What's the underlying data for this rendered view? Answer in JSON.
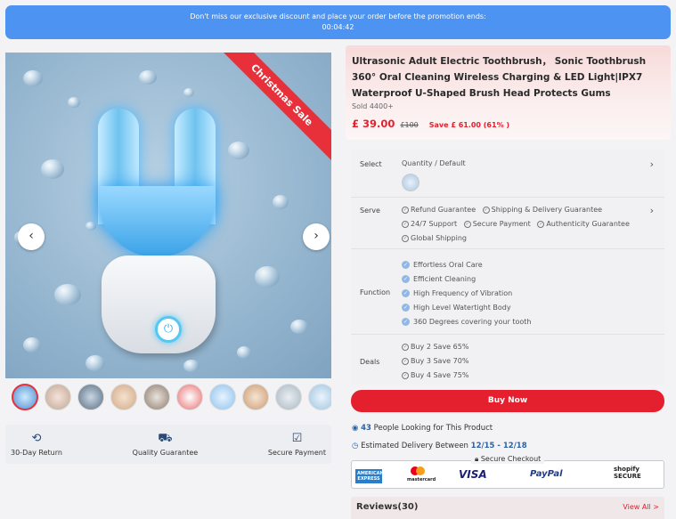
{
  "promo": {
    "message": "Don't miss our exclusive discount and place your order before the promotion ends:",
    "countdown": "00:04:42"
  },
  "gallery": {
    "ribbon": "Christmas Sale",
    "prev_icon": "chevron-left-icon",
    "next_icon": "chevron-right-icon",
    "thumbnail_count": 10
  },
  "guarantees": [
    {
      "label": "30-Day Return",
      "icon": "dollar-return-icon"
    },
    {
      "label": "Quality Guarantee",
      "icon": "truck-icon"
    },
    {
      "label": "Secure Payment",
      "icon": "secure-check-icon"
    }
  ],
  "product": {
    "title": "Ultrasonic Adult Electric Toothbrush， Sonic Toothbrush 360° Oral Cleaning Wireless Charging & LED Light|IPX7 Waterproof U-Shaped Brush Head Protects Gums",
    "sold": "Sold 4400+",
    "price": "£ 39.00",
    "old_price": "£100",
    "save": "Save £ 61.00 (61% )"
  },
  "specs": {
    "select_label": "Select",
    "select_value": "Quantity / Default",
    "serve_label": "Serve",
    "serve_items": [
      "Refund Guarantee",
      "Shipping & Delivery Guarantee",
      "24/7 Support",
      "Secure Payment",
      "Authenticity Guarantee",
      "Global Shipping"
    ],
    "function_label": "Function",
    "function_items": [
      "Effortless Oral Care",
      "Efficient Cleaning",
      "High Frequency of Vibration",
      "High Level Watertight Body",
      "360 Degrees covering your tooth"
    ],
    "deals_label": "Deals",
    "deals_items": [
      "Buy 2 Save 65%",
      "Buy 3 Save 70%",
      "Buy 4 Save 75%"
    ]
  },
  "buy_now": "Buy Now",
  "looking": {
    "count": "43",
    "text": "People Looking for This Product"
  },
  "delivery": {
    "label": "Estimated Delivery Between",
    "range": "12/15 - 12/18"
  },
  "checkout": {
    "title": "Secure Checkout",
    "logos": [
      "AMERICAN EXPRESS",
      "mastercard",
      "VISA",
      "PayPal",
      "shopify SECURE"
    ]
  },
  "reviews": {
    "title": "Reviews(30)",
    "view_all": "View All >"
  },
  "colors": {
    "accent": "#e5202e",
    "promo_blue": "#4d93f2",
    "link_blue": "#2a63a8"
  }
}
